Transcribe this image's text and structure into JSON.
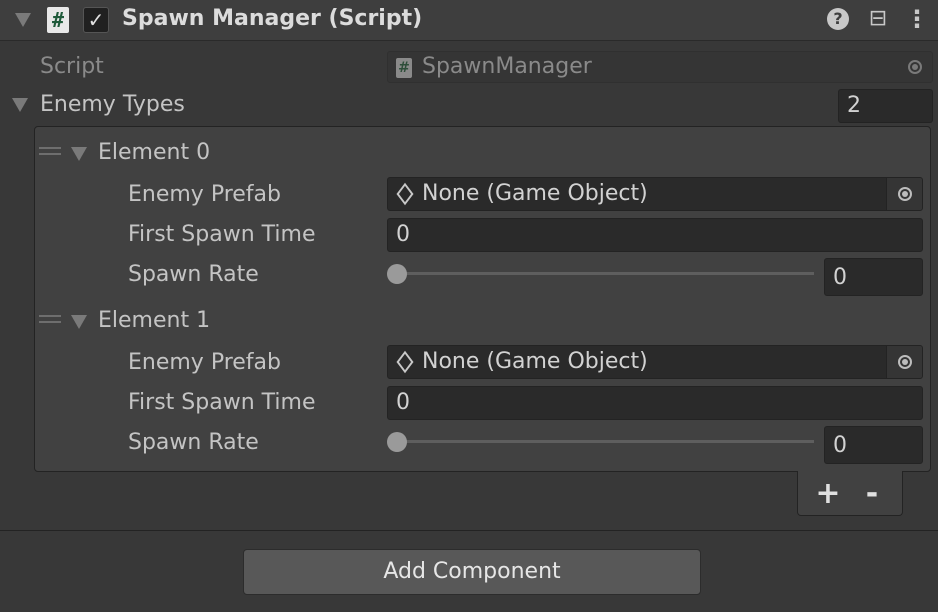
{
  "component": {
    "title": "Spawn Manager (Script)",
    "script_label": "Script",
    "script_value": "SpawnManager",
    "enabled": true
  },
  "icons": {
    "script": "#",
    "check": "✓",
    "help": "?",
    "presets": "⊟",
    "menu": "⋮"
  },
  "enemy_types": {
    "label": "Enemy Types",
    "size": "2",
    "elements": [
      {
        "label": "Element 0",
        "prefab_label": "Enemy Prefab",
        "prefab_value": "None (Game Object)",
        "first_spawn_label": "First Spawn Time",
        "first_spawn_value": "0",
        "spawn_rate_label": "Spawn Rate",
        "spawn_rate_value": "0",
        "spawn_rate_fraction": 0
      },
      {
        "label": "Element 1",
        "prefab_label": "Enemy Prefab",
        "prefab_value": "None (Game Object)",
        "first_spawn_label": "First Spawn Time",
        "first_spawn_value": "0",
        "spawn_rate_label": "Spawn Rate",
        "spawn_rate_value": "0",
        "spawn_rate_fraction": 0
      }
    ],
    "add_label": "+",
    "remove_label": "-"
  },
  "add_component_label": "Add Component"
}
